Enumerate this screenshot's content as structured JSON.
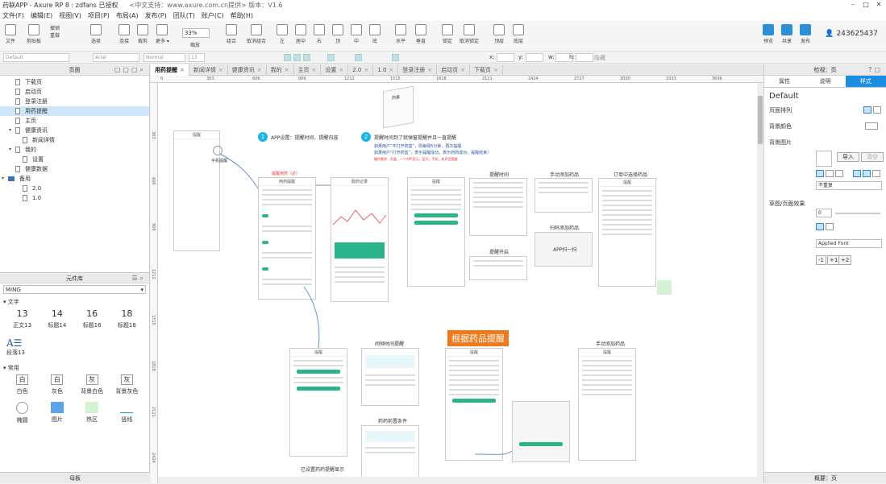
{
  "window": {
    "title": "药联APP - Axure RP 8 : zdfans 已授权",
    "title_extra": "<中文支持：www.axure.com.cn提供> 版本：V1.6"
  },
  "menu": [
    "文件(F)",
    "编辑(E)",
    "视图(V)",
    "项目(P)",
    "布局(A)",
    "发布(P)",
    "团队(T)",
    "账户(C)",
    "帮助(H)"
  ],
  "toolbar": {
    "file": "文件",
    "clipboard": "剪贴板",
    "undo": "撤销",
    "redo": "重做",
    "select": "选择",
    "connect": "连接",
    "crop": "裁剪",
    "more": "更多 ▾",
    "zoom": "33%",
    "zoom_label": "缩放",
    "group": "组合",
    "ungroup": "取消组合",
    "align_left": "左",
    "align_center": "居中",
    "align_right": "右",
    "align_top": "顶",
    "align_middle": "中",
    "align_bottom": "底",
    "dist_h": "水平",
    "dist_v": "垂直",
    "lock": "锁定",
    "unlock": "取消锁定",
    "front": "顶层",
    "back": "底层",
    "preview": "预览",
    "share": "共享",
    "publish": "发布",
    "user": "243625437"
  },
  "formatbar": {
    "style": "Default",
    "font": "Arial",
    "weight": "Normal",
    "size": "13",
    "x_label": "x:",
    "y_label": "y:",
    "w_label": "w:",
    "h_label": "h:",
    "hidden": "隐藏"
  },
  "left": {
    "pages_title": "页面",
    "pages": [
      {
        "name": "下载页",
        "indent": 1
      },
      {
        "name": "启动页",
        "indent": 1
      },
      {
        "name": "登录注册",
        "indent": 1
      },
      {
        "name": "用药提醒",
        "indent": 1,
        "sel": true
      },
      {
        "name": "主页",
        "indent": 1
      },
      {
        "name": "健康资讯",
        "indent": 1,
        "toggle": true
      },
      {
        "name": "新闻详情",
        "indent": 2
      },
      {
        "name": "我的",
        "indent": 1,
        "toggle": true
      },
      {
        "name": "设置",
        "indent": 2
      },
      {
        "name": "健康数据",
        "indent": 1
      },
      {
        "name": "备用",
        "indent": 0,
        "folder": true
      },
      {
        "name": "2.0",
        "indent": 2
      },
      {
        "name": "1.0",
        "indent": 2
      }
    ],
    "lib_title": "元件库",
    "lib_selected": "MING",
    "sec_text": "文字",
    "sec_common": "常用",
    "text_widgets": [
      {
        "v": "13",
        "l": "正文13"
      },
      {
        "v": "14",
        "l": "标题14"
      },
      {
        "v": "16",
        "l": "标题16"
      },
      {
        "v": "18",
        "l": "标题18"
      }
    ],
    "para": "段落13",
    "common_widgets": [
      {
        "v": "白",
        "l": "白色"
      },
      {
        "v": "白",
        "l": "灰色"
      },
      {
        "v": "灰",
        "l": "背景白色"
      },
      {
        "v": "灰",
        "l": "背景灰色"
      }
    ],
    "common2": [
      "椭圆",
      "图片",
      "热区",
      "竖线"
    ],
    "master": "母板"
  },
  "tabs": [
    "用药提醒",
    "新闻详情",
    "健康资讯",
    "我的",
    "主页",
    "设置",
    "2.0",
    "1.0",
    "登录注册",
    "启动页",
    "下载页"
  ],
  "rulers": {
    "h": [
      "0",
      "303",
      "606",
      "909",
      "1212",
      "1515",
      "1818",
      "2121",
      "2424",
      "2727",
      "3030",
      "3333",
      "3636"
    ],
    "v": [
      "303",
      "606",
      "909",
      "1212",
      "1515",
      "1818",
      "2121",
      "2424"
    ]
  },
  "canvas": {
    "s1": "APP设置：提醒时间，提醒内容",
    "s2": "提醒时间到了就弹窗提醒并且一直提醒",
    "note1": "如果用户“不打开药盒”，则每隔5分钟，再次提醒",
    "note2": "如果用户“打开药盒”，表示提醒成功，表示药药成功，提醒结束）",
    "red1": "硬件需求：药盒，一个APP显示，蓝牙，手机，有声音提醒",
    "red2": "提醒用药（必）",
    "title_remind": "提醒时间",
    "title_add": "手动添加药品",
    "title_order": "订单中选择药品",
    "title_scan": "扫码添加药品",
    "scan_text": "APP扫一扫",
    "title_open": "提醒开启",
    "orange": "根据药品提醒",
    "title_shake": "闹钟时间提醒",
    "title_medset": "药药前置条件",
    "caption": "已设置药药提醒显示",
    "added": "手动添加药品",
    "mock_title": "用药提醒",
    "alarm_title": "服药记录",
    "box_label": "药盒",
    "phone_label": "手机提醒"
  },
  "right": {
    "title": "检视：页",
    "tabs": [
      "属性",
      "说明",
      "样式"
    ],
    "style": "Default",
    "page_align": "页面排列",
    "bg_color": "背景颜色",
    "bg_image": "背景图片",
    "import": "导入",
    "clear": "清空",
    "repeat": "不重复",
    "sketch": "草图/页面效果",
    "sketch_value": "0",
    "font": "Applied Font",
    "btn1": "-1",
    "btn2": "+1",
    "btn3": "+2",
    "bottom": "概要：页"
  }
}
